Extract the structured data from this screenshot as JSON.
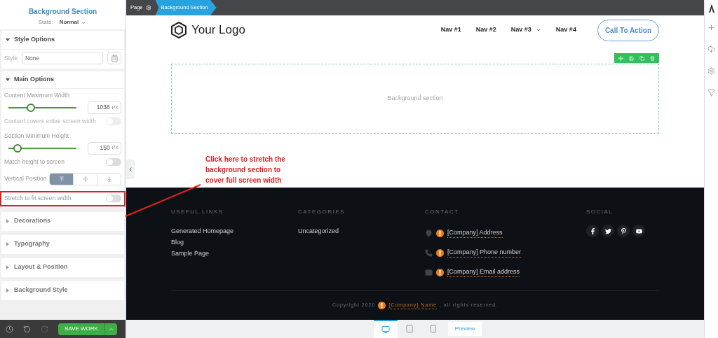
{
  "panel": {
    "title": "Background Section",
    "state_label": "State:",
    "state_value": "Normal",
    "style_options": {
      "title": "Style Options",
      "expanded": true,
      "style_label": "Style",
      "style_value": "None"
    },
    "main_options": {
      "title": "Main Options",
      "expanded": true,
      "sliders": [
        {
          "label": "Content Maximum Width",
          "level": 0.33,
          "value": "1038",
          "unit": "PX"
        },
        {
          "label": "Section Minimum Height",
          "level": 0.13,
          "value": "150",
          "unit": "PX"
        }
      ],
      "toggles": [
        {
          "label": "Content covers entire screen width",
          "on": false,
          "disabled": true,
          "highlighted": false
        },
        {
          "label": "Match height to screen",
          "on": false,
          "disabled": false,
          "highlighted": false
        },
        {
          "label": "Stretch to fit screen width",
          "on": false,
          "disabled": false,
          "highlighted": true
        }
      ],
      "vertical_position": {
        "label": "Vertical Position",
        "options": [
          {
            "kind": "top",
            "selected": true
          },
          {
            "kind": "middle",
            "selected": false
          },
          {
            "kind": "bottom",
            "selected": false
          }
        ]
      }
    },
    "collapsed_sections": [
      {
        "title": "Decorations",
        "expanded": false
      },
      {
        "title": "Typography",
        "expanded": false
      },
      {
        "title": "Layout & Position",
        "expanded": false
      },
      {
        "title": "Background Style",
        "expanded": false
      }
    ],
    "footer_bar": {
      "save": "SAVE WORK"
    }
  },
  "breadcrumb": [
    {
      "label": "Page",
      "selected": false
    },
    {
      "label": "Background Section",
      "selected": true
    }
  ],
  "site": {
    "logo": "Your Logo",
    "nav": [
      {
        "label": "Nav #1",
        "dropdown": false
      },
      {
        "label": "Nav #2",
        "dropdown": false
      },
      {
        "label": "Nav #3",
        "dropdown": true
      },
      {
        "label": "Nav #4",
        "dropdown": false
      }
    ],
    "cta": "Call To Action",
    "section_placeholder": "Background section",
    "footer": {
      "columns": [
        {
          "heading": "USEFUL LINKS",
          "links": [
            "Generated Homepage",
            "Blog",
            "Sample Page"
          ]
        },
        {
          "heading": "CATEGORIES",
          "links": [
            "Uncategorized"
          ]
        }
      ],
      "contact": {
        "heading": "CONTACT",
        "items": [
          {
            "kind": "address",
            "text": "[Company] Address"
          },
          {
            "kind": "phone",
            "text": "[Company] Phone number"
          },
          {
            "kind": "email",
            "text": "[Company] Email address"
          }
        ]
      },
      "social": {
        "heading": "SOCIAL",
        "items": [
          {
            "kind": "facebook"
          },
          {
            "kind": "twitter"
          },
          {
            "kind": "pinterest"
          },
          {
            "kind": "youtube"
          }
        ]
      },
      "copyright": {
        "before": "Copyright 2020",
        "company": "[Company] Name",
        "after": ", all rights reserved."
      }
    }
  },
  "devices": [
    {
      "kind": "desktop",
      "selected": true
    },
    {
      "kind": "tablet",
      "selected": false
    },
    {
      "kind": "phone",
      "selected": false
    }
  ],
  "preview": "Preview",
  "annotation": "Click here to stretch the background section to cover full screen width"
}
